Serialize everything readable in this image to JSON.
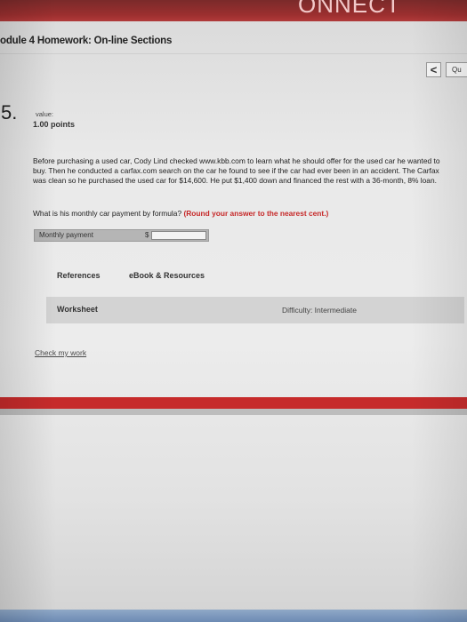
{
  "brand": "ONNECT",
  "header": {
    "title": "odule 4 Homework: On-line Sections"
  },
  "nav": {
    "prev_symbol": "<",
    "question_label": "Qu"
  },
  "question": {
    "number": "5.",
    "value_label": "value:",
    "points": "1.00 points",
    "body": "Before purchasing a used car, Cody Lind checked www.kbb.com to learn what he should offer for the used car he wanted to buy. Then he conducted a carfax.com search on the car he found to see if the car had ever been in an accident. The Carfax was clean so he purchased the used car for $14,600. He put $1,400 down and financed the rest with a 36-month, 8% loan.",
    "prompt": "What is his monthly car payment by formula?",
    "round_note": "(Round your answer to the nearest cent.)"
  },
  "answer": {
    "label": "Monthly payment",
    "currency": "$",
    "value": ""
  },
  "tabs": {
    "references": "References",
    "ebook": "eBook & Resources"
  },
  "worksheet": {
    "label": "Worksheet",
    "difficulty": "Difficulty: Intermediate"
  },
  "check_work": "Check my work",
  "colors": {
    "accent_red": "#c62828",
    "stripe_red": "#c62b2b"
  }
}
